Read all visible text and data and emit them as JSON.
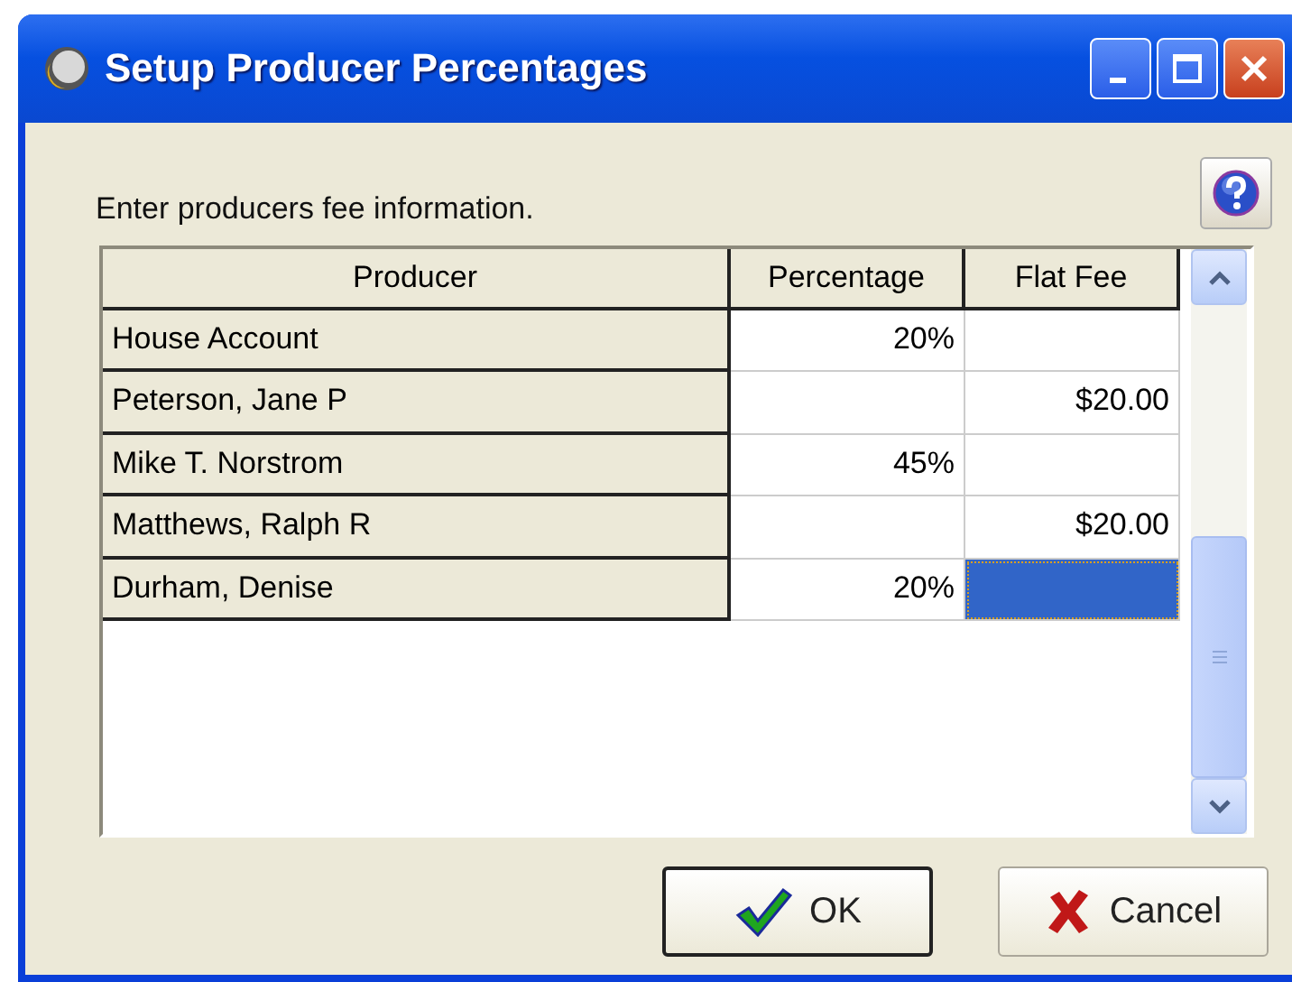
{
  "window": {
    "title": "Setup Producer Percentages"
  },
  "instruction": "Enter producers fee information.",
  "table": {
    "columns": [
      "Producer",
      "Percentage",
      "Flat Fee"
    ],
    "rows": [
      {
        "producer": "House Account",
        "percentage": "20%",
        "flat_fee": "",
        "selected": false
      },
      {
        "producer": "Peterson, Jane P",
        "percentage": "",
        "flat_fee": "$20.00",
        "selected": false
      },
      {
        "producer": "Mike T. Norstrom",
        "percentage": "45%",
        "flat_fee": "",
        "selected": false
      },
      {
        "producer": "Matthews, Ralph R",
        "percentage": "",
        "flat_fee": "$20.00",
        "selected": false
      },
      {
        "producer": "Durham, Denise",
        "percentage": "20%",
        "flat_fee": "",
        "selected": true
      }
    ]
  },
  "buttons": [
    {
      "kind": "ok",
      "label": "OK",
      "default": true
    },
    {
      "kind": "cancel",
      "label": "Cancel",
      "default": false
    }
  ]
}
